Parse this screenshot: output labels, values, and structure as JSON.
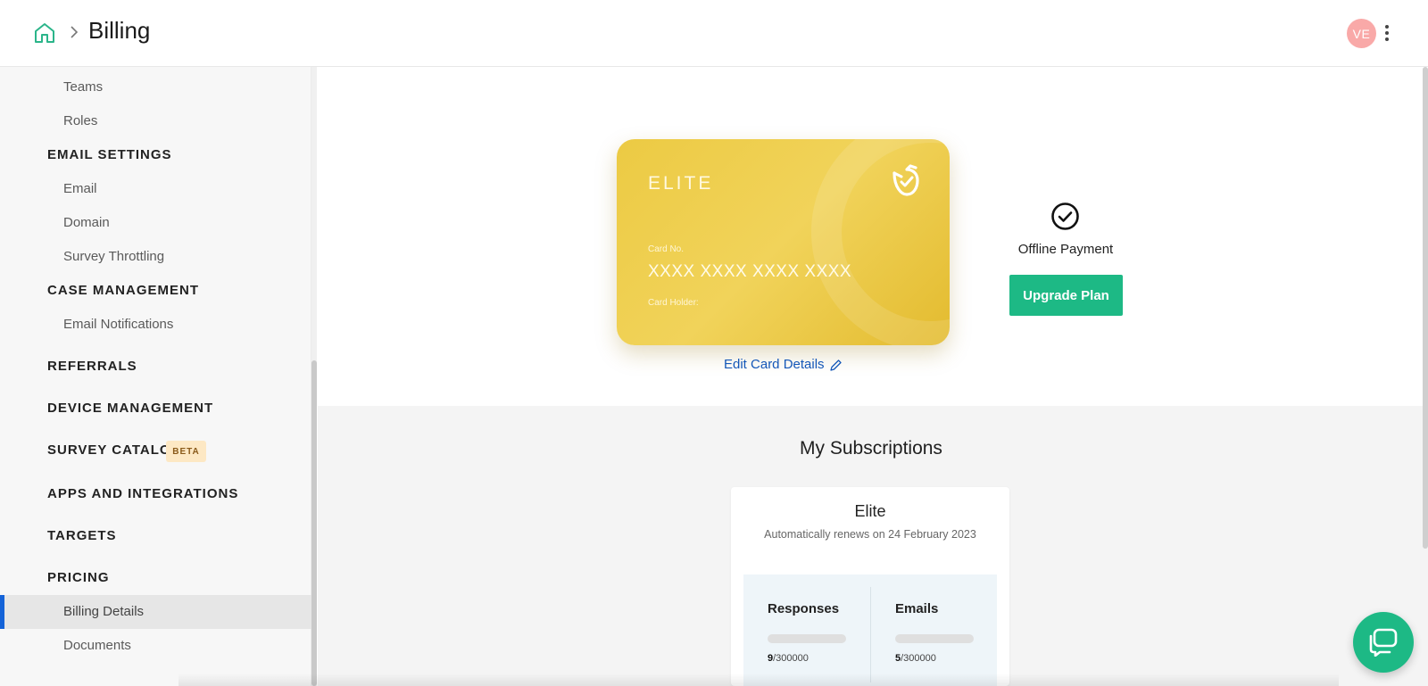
{
  "header": {
    "title": "Billing",
    "avatar_initials": "VE",
    "avatar_color": "#f9a9a8"
  },
  "sidebar": {
    "items": [
      {
        "label": "Teams",
        "type": "item"
      },
      {
        "label": "Roles",
        "type": "item"
      },
      {
        "label": "EMAIL SETTINGS",
        "type": "section"
      },
      {
        "label": "Email",
        "type": "item"
      },
      {
        "label": "Domain",
        "type": "item"
      },
      {
        "label": "Survey Throttling",
        "type": "item"
      },
      {
        "label": "CASE MANAGEMENT",
        "type": "section"
      },
      {
        "label": "Email Notifications",
        "type": "item"
      },
      {
        "label": "REFERRALS",
        "type": "section"
      },
      {
        "label": "DEVICE MANAGEMENT",
        "type": "section"
      },
      {
        "label": "SURVEY CATALOG",
        "type": "section"
      },
      {
        "label": "APPS AND INTEGRATIONS",
        "type": "section"
      },
      {
        "label": "TARGETS",
        "type": "section"
      },
      {
        "label": "PRICING",
        "type": "section"
      },
      {
        "label": "Billing Details",
        "type": "item",
        "active": true
      },
      {
        "label": "Documents",
        "type": "item"
      }
    ],
    "beta_badge": "BETA",
    "active_color": "#1463d8"
  },
  "card": {
    "tier": "ELITE",
    "card_no_label": "Card No.",
    "card_number": "XXXX XXXX XXXX XXXX",
    "card_holder_label": "Card Holder:",
    "edit_link": "Edit Card Details"
  },
  "payment": {
    "method": "Offline Payment",
    "upgrade_label": "Upgrade Plan",
    "accent": "#1db985"
  },
  "subscriptions": {
    "title": "My Subscriptions",
    "plan": "Elite",
    "renewal": "Automatically renews on 24 February 2023",
    "usage": [
      {
        "label": "Responses",
        "used": "9",
        "limit": "/300000",
        "fraction": 3e-05
      },
      {
        "label": "Emails",
        "used": "5",
        "limit": "/300000",
        "fraction": 1.7e-05
      }
    ]
  },
  "icons": {
    "home": "home-icon",
    "breadcrumb": "chevron-right-icon",
    "menu": "kebab-menu-icon",
    "card_logo": "bird-logo-icon",
    "edit": "pencil-icon",
    "payment_status": "check-circle-icon",
    "chat": "chat-bubble-icon"
  }
}
